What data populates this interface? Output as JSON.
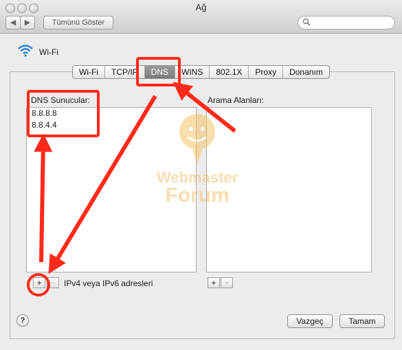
{
  "window": {
    "title": "Ağ",
    "show_all_label": "Tümünü Göster",
    "search_placeholder": ""
  },
  "interface": {
    "name": "Wi-Fi",
    "icon": "wifi-icon"
  },
  "tabs": [
    "Wi-Fi",
    "TCP/IP",
    "DNS",
    "WINS",
    "802.1X",
    "Proxy",
    "Donanım"
  ],
  "active_tab": "DNS",
  "dns_servers": {
    "label": "DNS Sunucular:",
    "items": [
      "8.8.8.8",
      "8.8.4.4"
    ],
    "add_label": "+",
    "remove_label": "−",
    "hint": "IPv4 veya IPv6 adresleri"
  },
  "search_domains": {
    "label": "Arama Alanları:",
    "items": [],
    "add_label": "+",
    "remove_label": "−"
  },
  "footer": {
    "help_label": "?",
    "cancel_label": "Vazgeç",
    "ok_label": "Tamam"
  },
  "watermark": {
    "line1": "Webmaster",
    "line2": "Forum"
  },
  "colors": {
    "highlight": "#ff2a1a",
    "active_tab": "#8a8a8a",
    "watermark": "#f2c36f"
  }
}
